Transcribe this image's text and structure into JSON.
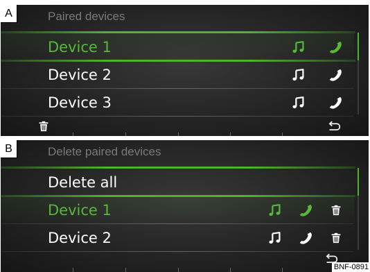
{
  "colors": {
    "accent": "#4fb330",
    "selected_text": "#58b83a",
    "text": "#ffffff",
    "header_text": "#7a7a7a"
  },
  "panel_a": {
    "label": "A",
    "header": "Paired devices",
    "rows": [
      {
        "label": "Device 1",
        "selected": true,
        "icons": [
          "music-icon",
          "phone-icon"
        ]
      },
      {
        "label": "Device 2",
        "selected": false,
        "icons": [
          "music-icon",
          "phone-icon"
        ]
      },
      {
        "label": "Device 3",
        "selected": false,
        "icons": [
          "music-icon",
          "phone-icon"
        ]
      }
    ],
    "bottom_icons": [
      "trash-icon",
      "back-icon"
    ]
  },
  "panel_b": {
    "label": "B",
    "header": "Delete paired devices",
    "rows": [
      {
        "label": "Delete all",
        "selected": false,
        "icons": []
      },
      {
        "label": "Device 1",
        "selected": true,
        "icons": [
          "music-icon",
          "phone-icon",
          "trash-icon"
        ]
      },
      {
        "label": "Device 2",
        "selected": false,
        "icons": [
          "music-icon",
          "phone-icon",
          "trash-icon"
        ]
      }
    ],
    "bottom_icons": [
      "back-icon"
    ]
  },
  "figure_ref": "BNF-0891"
}
